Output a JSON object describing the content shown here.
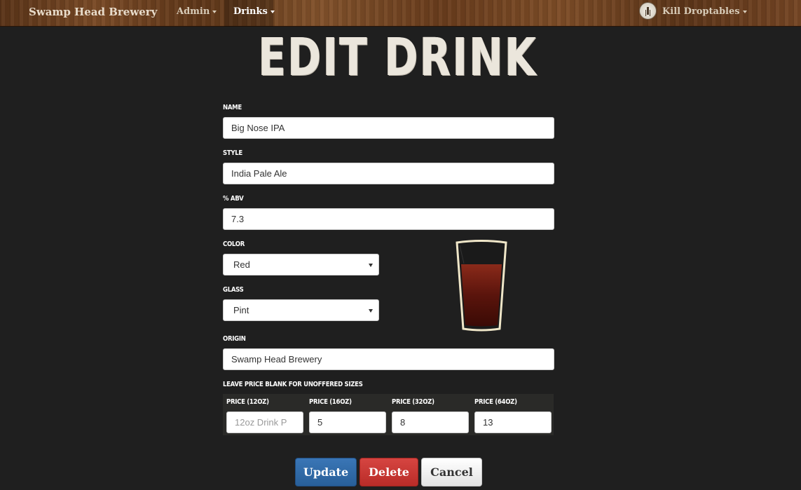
{
  "navbar": {
    "brand": "Swamp Head Brewery",
    "admin_label": "Admin",
    "drinks_label": "Drinks",
    "user_label": "Kill Droptables"
  },
  "page": {
    "title": "EDIT DRINK"
  },
  "form": {
    "name": {
      "label": "NAME",
      "value": "Big Nose IPA"
    },
    "style": {
      "label": "STYLE",
      "value": "India Pale Ale"
    },
    "abv": {
      "label": "% ABV",
      "value": "7.3"
    },
    "color": {
      "label": "COLOR",
      "value": "Red"
    },
    "glass": {
      "label": "GLASS",
      "value": "Pint"
    },
    "origin": {
      "label": "ORIGIN",
      "value": "Swamp Head Brewery"
    },
    "prices_note": "LEAVE PRICE BLANK FOR UNOFFERED SIZES",
    "prices": [
      {
        "label": "PRICE (12OZ)",
        "value": "",
        "placeholder": "12oz Drink P"
      },
      {
        "label": "PRICE (16OZ)",
        "value": "5",
        "placeholder": ""
      },
      {
        "label": "PRICE (32OZ)",
        "value": "8",
        "placeholder": ""
      },
      {
        "label": "PRICE (64OZ)",
        "value": "13",
        "placeholder": ""
      }
    ]
  },
  "preview": {
    "drink_color": "#6b1a10",
    "glass_outline": "#efe6c8"
  },
  "buttons": {
    "update": "Update",
    "delete": "Delete",
    "cancel": "Cancel"
  },
  "icons": {
    "select_arrow": "chevron-down-icon",
    "caret": "caret-down-icon",
    "avatar": "user-avatar-icon"
  }
}
